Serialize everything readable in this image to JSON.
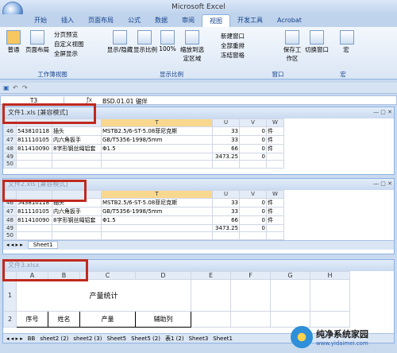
{
  "app": {
    "window_title": "Microsoft Excel"
  },
  "tabs": [
    "开始",
    "插入",
    "页面布局",
    "公式",
    "数据",
    "审阅",
    "视图",
    "开发工具",
    "Acrobat"
  ],
  "active_tab": "视图",
  "ribbon": {
    "workbook_views": {
      "label": "工作簿视图",
      "items": [
        "普通",
        "页面布局",
        "分页预览",
        "自定义视图",
        "全屏显示"
      ]
    },
    "show_hide": {
      "label": "显示/隐藏"
    },
    "zoom": {
      "label": "显示比例",
      "items": [
        "显示比例",
        "100%",
        "缩放到选定区域"
      ]
    },
    "window": {
      "label": "窗口",
      "items": [
        "新建窗口",
        "全部重排",
        "冻结窗格",
        "保存工作区",
        "切换窗口"
      ]
    },
    "macro": {
      "label": "宏",
      "items": [
        "宏"
      ]
    }
  },
  "formula_bar": {
    "name_box": "T3",
    "value": "BSD.01.01 锯伴"
  },
  "win1": {
    "title": "文件1.xls  [兼容模式]",
    "cols": [
      "T",
      "U",
      "V",
      "W"
    ],
    "rows": [
      {
        "n": "46",
        "a": "543810118",
        "b": "插头",
        "t": "MSTB2.5/6-ST-5.08菲尼克斯",
        "u": "33",
        "v": "0",
        "w": "件"
      },
      {
        "n": "47",
        "a": "811110105",
        "b": "内六角扳手",
        "t": "GB/T5356-1998/5mm",
        "u": "33",
        "v": "0",
        "w": "件"
      },
      {
        "n": "48",
        "a": "811410090",
        "b": "8字形钢丝绳铝套",
        "t": "Φ1.5",
        "u": "66",
        "v": "0",
        "w": "件"
      },
      {
        "n": "49",
        "a": "",
        "b": "",
        "t": "",
        "u": "3473.25",
        "v": "0",
        "w": ""
      },
      {
        "n": "50",
        "a": "",
        "b": "",
        "t": "",
        "u": "",
        "v": "",
        "w": ""
      }
    ]
  },
  "win2": {
    "title": "文件2.xls  [兼容模式]",
    "cols": [
      "T",
      "U",
      "V",
      "W"
    ],
    "rows": [
      {
        "n": "46",
        "a": "543810118",
        "b": "插头",
        "t": "MSTB2.5/6-ST-5.08菲尼克斯",
        "u": "33",
        "v": "0",
        "w": "件"
      },
      {
        "n": "47",
        "a": "811110105",
        "b": "内六角扳手",
        "t": "GB/T5356-1998/5mm",
        "u": "33",
        "v": "0",
        "w": "件"
      },
      {
        "n": "48",
        "a": "811410090",
        "b": "8字形钢丝绳铝套",
        "t": "Φ1.5",
        "u": "66",
        "v": "0",
        "w": "件"
      },
      {
        "n": "49",
        "a": "",
        "b": "",
        "t": "",
        "u": "3473.25",
        "v": "0",
        "w": ""
      },
      {
        "n": "50",
        "a": "",
        "b": "",
        "t": "",
        "u": "",
        "v": "",
        "w": ""
      }
    ],
    "sheet": "Sheet1"
  },
  "win3": {
    "title": "文件3.xlsx",
    "cols": [
      "A",
      "B",
      "C",
      "D",
      "E",
      "F",
      "G",
      "H"
    ],
    "title_cell": "产量统计",
    "headers": [
      "序号",
      "姓名",
      "产量",
      "辅助列"
    ],
    "sheets": [
      "BB",
      "sheet2 (2)",
      "sheet2 (3)",
      "Sheet5",
      "Sheet5 (2)",
      "表1 (2)",
      "Sheet3",
      "Sheet1"
    ]
  },
  "watermark": {
    "site": "纯净系统家园",
    "url": "www.yidaimei.com"
  }
}
